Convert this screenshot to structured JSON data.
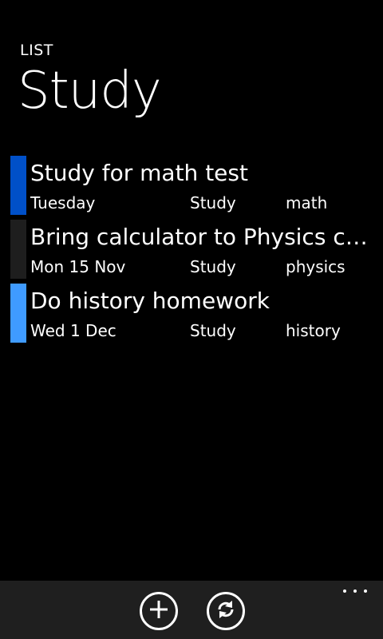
{
  "header": {
    "section_label": "LIST",
    "title": "Study"
  },
  "tasks": [
    {
      "title": "Study for math test",
      "date": "Tuesday",
      "list": "Study",
      "tag": "math",
      "color": "#0050c8"
    },
    {
      "title": "Bring calculator to Physics cl...",
      "date": "Mon 15 Nov",
      "list": "Study",
      "tag": "physics",
      "color": "#1e1e1e"
    },
    {
      "title": "Do history homework",
      "date": "Wed 1 Dec",
      "list": "Study",
      "tag": "history",
      "color": "#3f9bff"
    }
  ],
  "appbar": {
    "buttons": [
      {
        "name": "add",
        "icon": "plus-icon"
      },
      {
        "name": "sync",
        "icon": "sync-icon"
      }
    ],
    "more_icon": "ellipsis-icon"
  },
  "colors": {
    "background": "#000000",
    "appbar": "#1f1f1f",
    "text": "#ffffff"
  }
}
